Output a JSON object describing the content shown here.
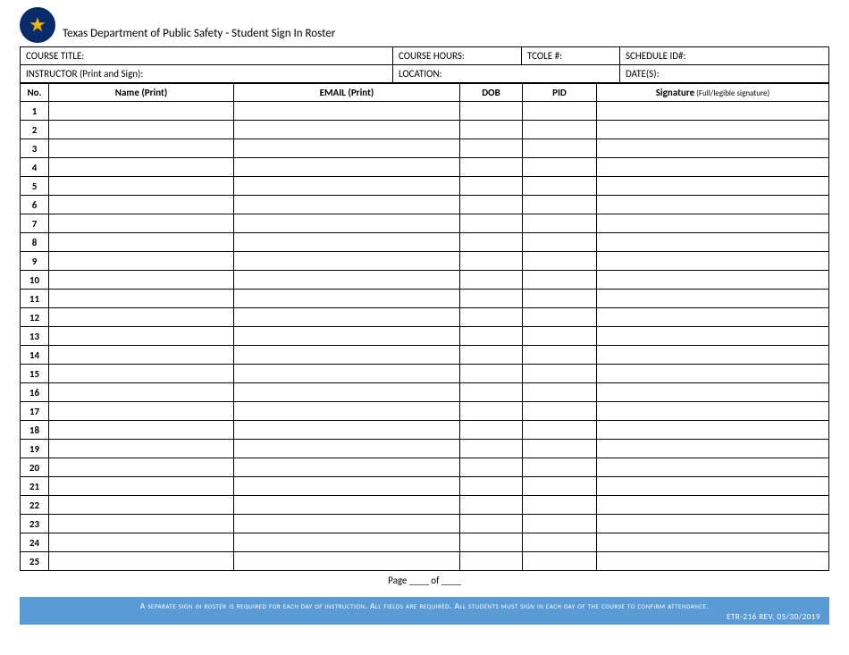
{
  "header": {
    "title": "Texas Department of Public Safety - Student Sign In Roster"
  },
  "info": {
    "course_title_label": "COURSE TITLE:",
    "course_hours_label": "COURSE HOURS:",
    "tcole_label": "TCOLE #:",
    "schedule_id_label": "SCHEDULE ID#:",
    "instructor_label": "INSTRUCTOR (Print and Sign):",
    "location_label": "LOCATION:",
    "dates_label": "DATE(S):"
  },
  "roster": {
    "columns": {
      "no": "No.",
      "name": "Name (Print)",
      "email": "EMAIL (Print)",
      "dob": "DOB",
      "pid": "PID",
      "signature": "Signature",
      "signature_hint": " (Full/legible signature)"
    },
    "rows": [
      {
        "no": "1"
      },
      {
        "no": "2"
      },
      {
        "no": "3"
      },
      {
        "no": "4"
      },
      {
        "no": "5"
      },
      {
        "no": "6"
      },
      {
        "no": "7"
      },
      {
        "no": "8"
      },
      {
        "no": "9"
      },
      {
        "no": "10"
      },
      {
        "no": "11"
      },
      {
        "no": "12"
      },
      {
        "no": "13"
      },
      {
        "no": "14"
      },
      {
        "no": "15"
      },
      {
        "no": "16"
      },
      {
        "no": "17"
      },
      {
        "no": "18"
      },
      {
        "no": "19"
      },
      {
        "no": "20"
      },
      {
        "no": "21"
      },
      {
        "no": "22"
      },
      {
        "no": "23"
      },
      {
        "no": "24"
      },
      {
        "no": "25"
      }
    ]
  },
  "pagination": {
    "text": "Page ____ of ____"
  },
  "footer": {
    "notice": "A separate sign in roster is required for each day of instruction. All fields are required. All students must sign in each day of the course to confirm attendance.",
    "revision": "ETR-216 REV. 05/30/2019"
  }
}
